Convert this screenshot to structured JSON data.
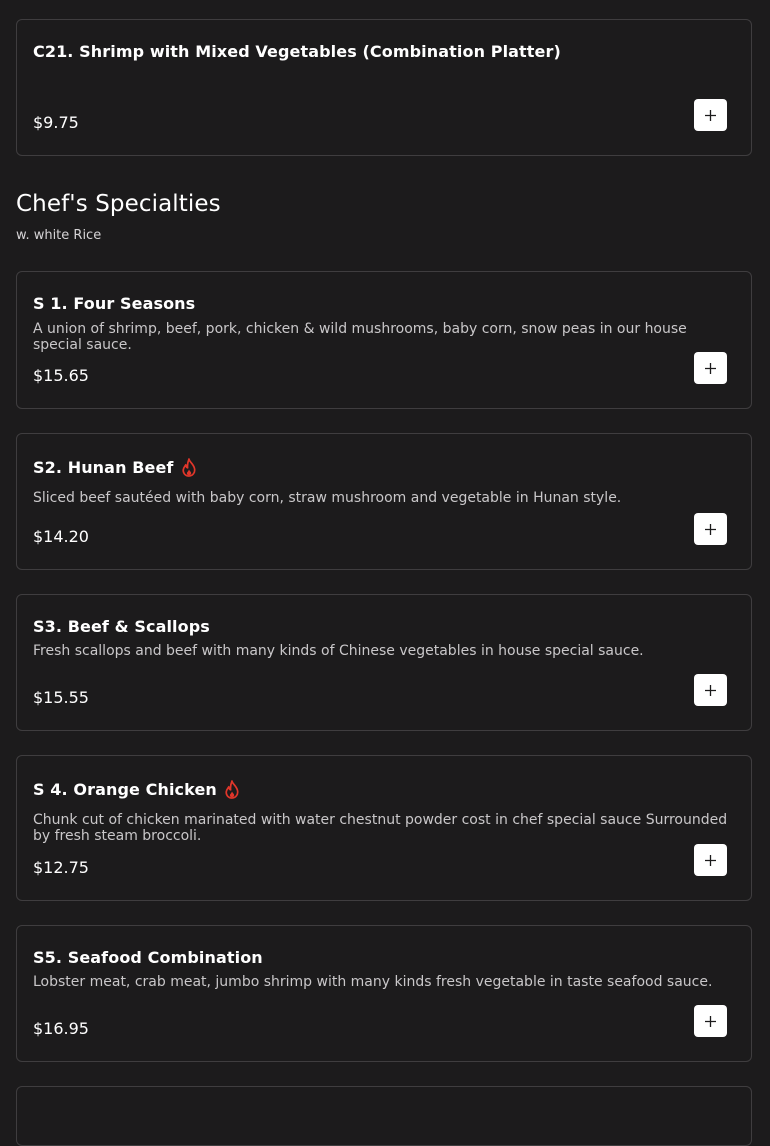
{
  "colors": {
    "background": "#1c1b1c",
    "card_border": "#3f3d3f",
    "spicy": "#e0362a",
    "button": "#ffffff"
  },
  "top_item": {
    "title": "C21. Shrimp with Mixed Vegetables (Combination Platter)",
    "price": "$9.75"
  },
  "section": {
    "title": "Chef's Specialties",
    "subtitle": "w. white Rice"
  },
  "items": [
    {
      "title": "S 1. Four Seasons",
      "spicy": false,
      "description": "A union of shrimp, beef, pork, chicken & wild mushrooms, baby corn, snow peas in our house special sauce.",
      "price": "$15.65"
    },
    {
      "title": "S2. Hunan Beef",
      "spicy": true,
      "description": "Sliced beef sautéed with baby corn, straw mushroom and vegetable in Hunan style.",
      "price": "$14.20"
    },
    {
      "title": "S3. Beef & Scallops",
      "spicy": false,
      "description": "Fresh scallops and beef with many kinds of Chinese vegetables in house special sauce.",
      "price": "$15.55"
    },
    {
      "title": "S 4. Orange Chicken",
      "spicy": true,
      "description": "Chunk cut of chicken marinated with water chestnut powder cost in chef special sauce Surrounded by fresh steam broccoli.",
      "price": "$12.75"
    },
    {
      "title": "S5. Seafood Combination",
      "spicy": false,
      "description": "Lobster meat, crab meat, jumbo shrimp with many kinds fresh vegetable in taste seafood sauce.",
      "price": "$16.95"
    }
  ],
  "icons": {
    "add": "plus-icon",
    "spicy": "flame-icon"
  }
}
